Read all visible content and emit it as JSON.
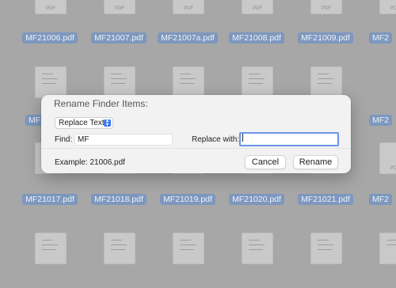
{
  "files_row1": [
    "MF21006.pdf",
    "MF21007.pdf",
    "MF21007a.pdf",
    "MF21008.pdf",
    "MF21009.pdf",
    "MF2"
  ],
  "files_row2_partial": [
    "MF2",
    "MF2"
  ],
  "files_row3": [
    "MF21017.pdf",
    "MF21018.pdf",
    "MF21019.pdf",
    "MF21020.pdf",
    "MF21021.pdf",
    "MF2"
  ],
  "thumb_label": "PDF",
  "dialog": {
    "title": "Rename Finder Items:",
    "mode": "Replace Text",
    "find_label": "Find:",
    "find_value": "MF",
    "replace_label": "Replace with:",
    "replace_value": "",
    "example": "Example: 21006.pdf",
    "cancel": "Cancel",
    "rename": "Rename"
  },
  "colors": {
    "selection": "#7d97be",
    "accent": "#3b78f6",
    "focus_ring": "#6a94e6"
  }
}
